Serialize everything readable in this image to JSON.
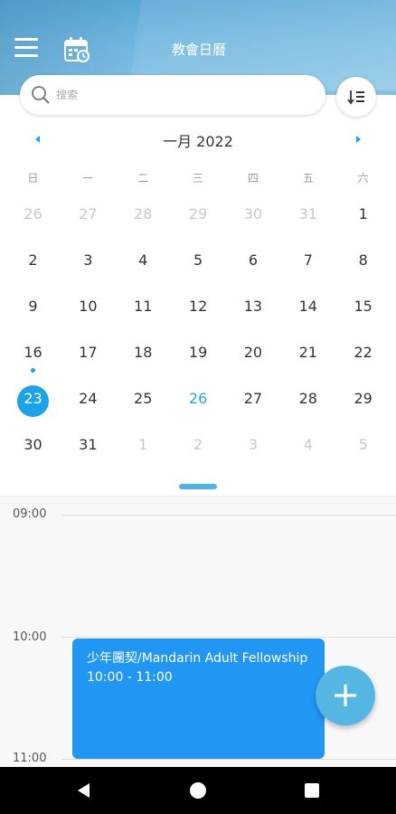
{
  "header": {
    "title": "教會日曆",
    "menu_icon": "hamburger-menu-icon",
    "app_icon": "calendar-icon"
  },
  "search": {
    "placeholder": "搜索",
    "icon": "search-icon"
  },
  "sort_button": {
    "icon": "sort-order-icon"
  },
  "calendar": {
    "month_label": "一月 2022",
    "weekdays": [
      "日",
      "一",
      "二",
      "三",
      "四",
      "五",
      "六"
    ],
    "weeks": [
      [
        {
          "d": "26",
          "other": true
        },
        {
          "d": "27",
          "other": true
        },
        {
          "d": "28",
          "other": true
        },
        {
          "d": "29",
          "other": true
        },
        {
          "d": "30",
          "other": true
        },
        {
          "d": "31",
          "other": true
        },
        {
          "d": "1"
        }
      ],
      [
        {
          "d": "2"
        },
        {
          "d": "3"
        },
        {
          "d": "4"
        },
        {
          "d": "5"
        },
        {
          "d": "6"
        },
        {
          "d": "7"
        },
        {
          "d": "8"
        }
      ],
      [
        {
          "d": "9"
        },
        {
          "d": "10"
        },
        {
          "d": "11"
        },
        {
          "d": "12"
        },
        {
          "d": "13"
        },
        {
          "d": "14"
        },
        {
          "d": "15"
        }
      ],
      [
        {
          "d": "16",
          "dot": true
        },
        {
          "d": "17"
        },
        {
          "d": "18"
        },
        {
          "d": "19"
        },
        {
          "d": "20"
        },
        {
          "d": "21"
        },
        {
          "d": "22"
        }
      ],
      [
        {
          "d": "23",
          "selected": true
        },
        {
          "d": "24"
        },
        {
          "d": "25"
        },
        {
          "d": "26",
          "today": true
        },
        {
          "d": "27"
        },
        {
          "d": "28"
        },
        {
          "d": "29"
        }
      ],
      [
        {
          "d": "30"
        },
        {
          "d": "31"
        },
        {
          "d": "1",
          "other": true
        },
        {
          "d": "2",
          "other": true
        },
        {
          "d": "3",
          "other": true
        },
        {
          "d": "4",
          "other": true
        },
        {
          "d": "5",
          "other": true
        }
      ]
    ],
    "accent_color": "#1ba3ea"
  },
  "timeline": {
    "hours": [
      "09:00",
      "10:00",
      "11:00"
    ]
  },
  "event": {
    "title": " 少年團契/Mandarin Adult Fellowship",
    "time": "10:00 - 11:00",
    "color": "#2196f3"
  },
  "fab": {
    "label": "+"
  },
  "system_nav": {
    "back_icon": "back-triangle-icon",
    "home_icon": "home-circle-icon",
    "recent_icon": "recent-apps-square-icon"
  }
}
